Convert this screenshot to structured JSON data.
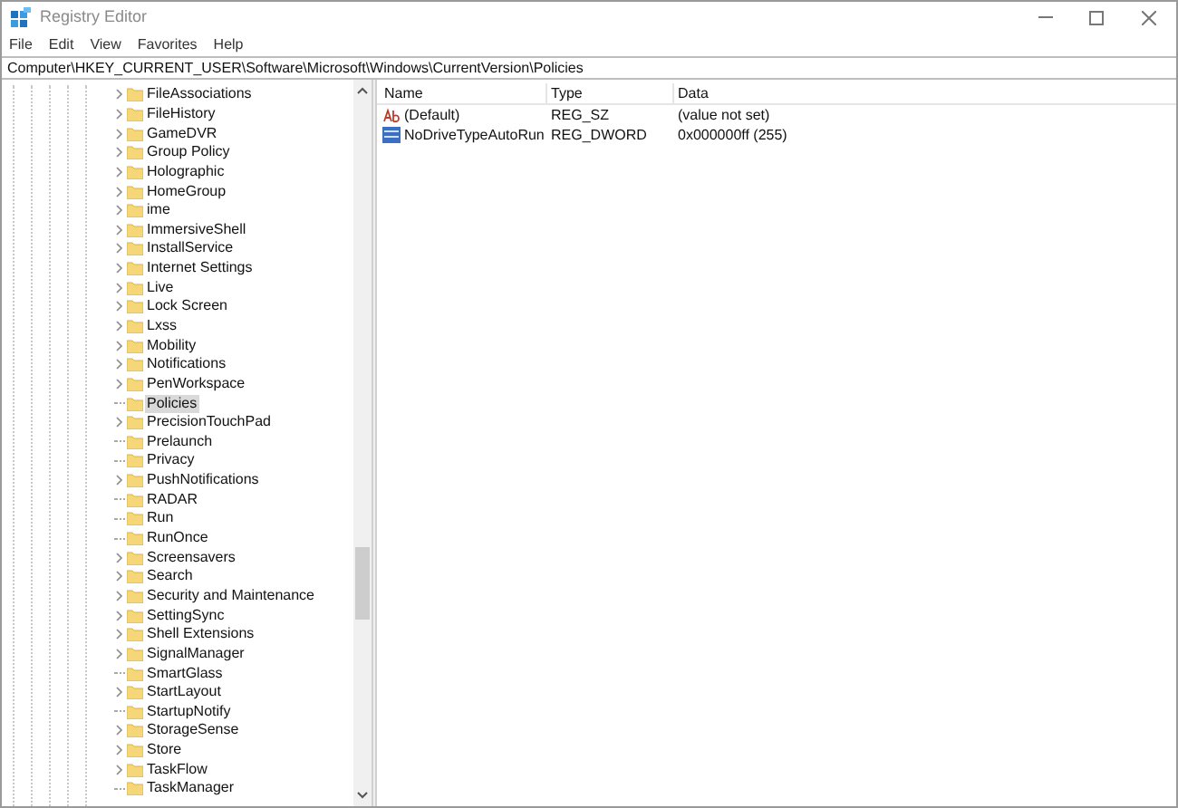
{
  "window": {
    "title": "Registry Editor"
  },
  "menu": [
    "File",
    "Edit",
    "View",
    "Favorites",
    "Help"
  ],
  "address": "Computer\\HKEY_CURRENT_USER\\Software\\Microsoft\\Windows\\CurrentVersion\\Policies",
  "tree": [
    {
      "label": "FileAssociations",
      "has_children": true,
      "selected": false
    },
    {
      "label": "FileHistory",
      "has_children": true,
      "selected": false
    },
    {
      "label": "GameDVR",
      "has_children": true,
      "selected": false
    },
    {
      "label": "Group Policy",
      "has_children": true,
      "selected": false
    },
    {
      "label": "Holographic",
      "has_children": true,
      "selected": false
    },
    {
      "label": "HomeGroup",
      "has_children": true,
      "selected": false
    },
    {
      "label": "ime",
      "has_children": true,
      "selected": false
    },
    {
      "label": "ImmersiveShell",
      "has_children": true,
      "selected": false
    },
    {
      "label": "InstallService",
      "has_children": true,
      "selected": false
    },
    {
      "label": "Internet Settings",
      "has_children": true,
      "selected": false
    },
    {
      "label": "Live",
      "has_children": true,
      "selected": false
    },
    {
      "label": "Lock Screen",
      "has_children": true,
      "selected": false
    },
    {
      "label": "Lxss",
      "has_children": true,
      "selected": false
    },
    {
      "label": "Mobility",
      "has_children": true,
      "selected": false
    },
    {
      "label": "Notifications",
      "has_children": true,
      "selected": false
    },
    {
      "label": "PenWorkspace",
      "has_children": true,
      "selected": false
    },
    {
      "label": "Policies",
      "has_children": false,
      "selected": true
    },
    {
      "label": "PrecisionTouchPad",
      "has_children": true,
      "selected": false
    },
    {
      "label": "Prelaunch",
      "has_children": false,
      "selected": false
    },
    {
      "label": "Privacy",
      "has_children": false,
      "selected": false
    },
    {
      "label": "PushNotifications",
      "has_children": true,
      "selected": false
    },
    {
      "label": "RADAR",
      "has_children": false,
      "selected": false
    },
    {
      "label": "Run",
      "has_children": false,
      "selected": false
    },
    {
      "label": "RunOnce",
      "has_children": false,
      "selected": false
    },
    {
      "label": "Screensavers",
      "has_children": true,
      "selected": false
    },
    {
      "label": "Search",
      "has_children": true,
      "selected": false
    },
    {
      "label": "Security and Maintenance",
      "has_children": true,
      "selected": false
    },
    {
      "label": "SettingSync",
      "has_children": true,
      "selected": false
    },
    {
      "label": "Shell Extensions",
      "has_children": true,
      "selected": false
    },
    {
      "label": "SignalManager",
      "has_children": true,
      "selected": false
    },
    {
      "label": "SmartGlass",
      "has_children": false,
      "selected": false
    },
    {
      "label": "StartLayout",
      "has_children": true,
      "selected": false
    },
    {
      "label": "StartupNotify",
      "has_children": false,
      "selected": false
    },
    {
      "label": "StorageSense",
      "has_children": true,
      "selected": false
    },
    {
      "label": "Store",
      "has_children": true,
      "selected": false
    },
    {
      "label": "TaskFlow",
      "has_children": true,
      "selected": false
    },
    {
      "label": "TaskManager",
      "has_children": false,
      "selected": false
    }
  ],
  "values": {
    "columns": [
      "Name",
      "Type",
      "Data"
    ],
    "rows": [
      {
        "kind": "string",
        "name": "(Default)",
        "type": "REG_SZ",
        "data": "(value not set)"
      },
      {
        "kind": "dword",
        "name": "NoDriveTypeAutoRun",
        "type": "REG_DWORD",
        "data": "0x000000ff (255)"
      }
    ]
  }
}
